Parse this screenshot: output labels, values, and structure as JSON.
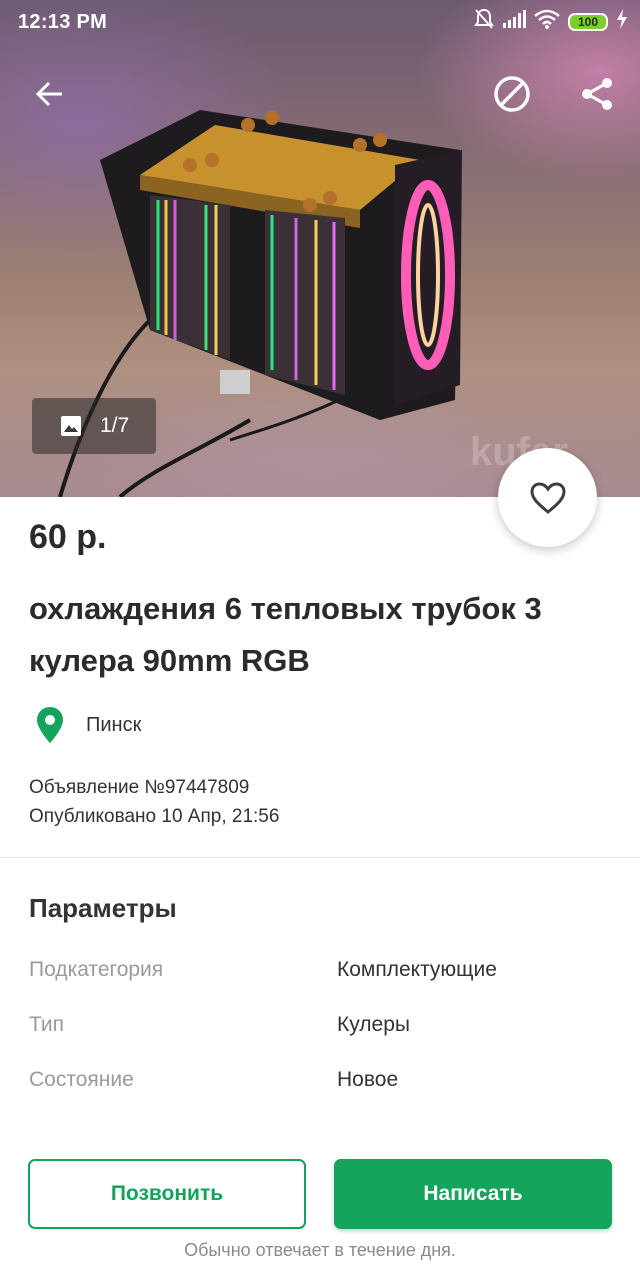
{
  "status_bar": {
    "time": "12:13 PM",
    "battery": "100",
    "icons": [
      "mute-icon",
      "signal-icon",
      "wifi-icon",
      "battery-icon",
      "charging-icon"
    ]
  },
  "toolbar": {
    "icons": [
      "back-arrow-icon",
      "block-icon",
      "share-icon"
    ]
  },
  "gallery": {
    "counter": "1/7",
    "watermark": "kufar"
  },
  "listing": {
    "price": "60 р.",
    "title": " охлаждения 6 тепловых трубок 3 кулера 90mm RGB",
    "location": "Пинск",
    "ad_number": "Объявление №97447809",
    "published": "Опубликовано 10 Апр, 21:56"
  },
  "params": {
    "heading": "Параметры",
    "rows": [
      {
        "label": "Подкатегория",
        "value": "Комплектующие"
      },
      {
        "label": "Тип",
        "value": "Кулеры"
      },
      {
        "label": "Состояние",
        "value": "Новое"
      }
    ]
  },
  "actions": {
    "call_label": "Позвонить",
    "write_label": "Написать",
    "reply_note": "Обычно отвечает в течение дня."
  },
  "colors": {
    "accent": "#15a45b",
    "text": "#2b2b2b",
    "muted": "#9a9a9a"
  }
}
